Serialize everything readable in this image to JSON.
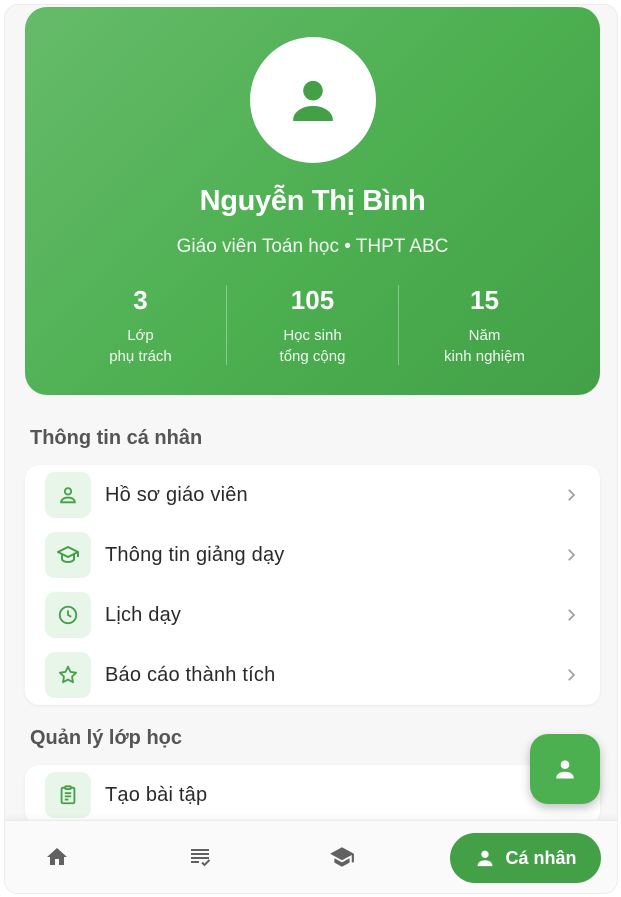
{
  "profile": {
    "name": "Nguyễn Thị Bình",
    "subtitle": "Giáo viên Toán học • THPT ABC",
    "stats": [
      {
        "value": "3",
        "label_line1": "Lớp",
        "label_line2": "phụ trách"
      },
      {
        "value": "105",
        "label_line1": "Học sinh",
        "label_line2": "tổng cộng"
      },
      {
        "value": "15",
        "label_line1": "Năm",
        "label_line2": "kinh nghiệm"
      }
    ]
  },
  "personal_section": {
    "title": "Thông tin cá nhân",
    "items": [
      {
        "label": "Hồ sơ giáo viên",
        "icon": "person-outline-icon"
      },
      {
        "label": "Thông tin giảng dạy",
        "icon": "school-outline-icon"
      },
      {
        "label": "Lịch dạy",
        "icon": "clock-icon"
      },
      {
        "label": "Báo cáo thành tích",
        "icon": "star-outline-icon"
      }
    ]
  },
  "class_section": {
    "title": "Quản lý lớp học",
    "items": [
      {
        "label": "Tạo bài tập",
        "icon": "assignment-icon"
      }
    ]
  },
  "bottom_nav": {
    "items": [
      {
        "icon": "home-icon"
      },
      {
        "icon": "list-check-icon"
      },
      {
        "icon": "school-icon"
      }
    ],
    "active_label": "Cá nhân",
    "active_icon": "person-icon"
  },
  "fab": {
    "icon": "person-icon"
  },
  "colors": {
    "primary": "#4caf50",
    "primary_dark": "#43a047",
    "icon_bg": "#e8f5e9"
  }
}
